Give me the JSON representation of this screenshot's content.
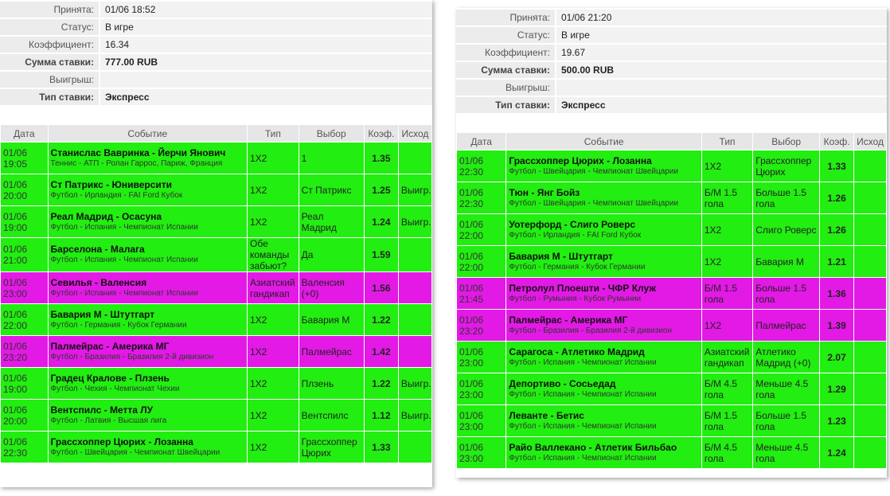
{
  "panels": [
    {
      "info": [
        {
          "label": "Принята:",
          "value": "01/06 18:52",
          "bold": false
        },
        {
          "label": "Статус:",
          "value": "В игре",
          "bold": false
        },
        {
          "label": "Коэффициент:",
          "value": "16.34",
          "bold": false
        },
        {
          "label": "Сумма ставки:",
          "value": "777.00 RUB",
          "bold": true
        },
        {
          "label": "Выигрыш:",
          "value": "",
          "bold": false
        },
        {
          "label": "Тип ставки:",
          "value": "Экспресс",
          "bold": true
        }
      ],
      "headers": [
        "Дата",
        "Событие",
        "Тип",
        "Выбор",
        "Коэф.",
        "Исход"
      ],
      "bets": [
        {
          "date": "01/06",
          "time": "19:05",
          "event": "Станислас Вавринка - Йерчи Янович",
          "sub": "Теннис - АТП - Ролан Гаррос, Париж, Франция",
          "type": "1Х2",
          "pick": "1",
          "odd": "1.35",
          "result": "",
          "color": "g"
        },
        {
          "date": "01/06",
          "time": "20:00",
          "event": "Ст Патрикс - Юниверсити",
          "sub": "Футбол - Ирландия - FAI Ford Кубок",
          "type": "1Х2",
          "pick": "Ст Патрикс",
          "odd": "1.25",
          "result": "Выигр.",
          "color": "g"
        },
        {
          "date": "01/06",
          "time": "19:00",
          "event": "Реал Мадрид - Осасуна",
          "sub": "Футбол - Испания - Чемпионат Испании",
          "type": "1Х2",
          "pick": "Реал Мадрид",
          "odd": "1.24",
          "result": "Выигр.",
          "color": "g"
        },
        {
          "date": "01/06",
          "time": "21:00",
          "event": "Барселона - Малага",
          "sub": "Футбол - Испания - Чемпионат Испании",
          "type": "Обе команды забьют?",
          "pick": "Да",
          "odd": "1.59",
          "result": "",
          "color": "g"
        },
        {
          "date": "01/06",
          "time": "23:00",
          "event": "Севилья - Валенсия",
          "sub": "Футбол - Испания - Чемпионат Испании",
          "type": "Азиатский гандикап",
          "pick": "Валенсия (+0)",
          "odd": "1.56",
          "result": "",
          "color": "m"
        },
        {
          "date": "01/06",
          "time": "22:00",
          "event": "Бавария М - Штутгарт",
          "sub": "Футбол - Германия - Кубок Германии",
          "type": "1Х2",
          "pick": "Бавария М",
          "odd": "1.22",
          "result": "",
          "color": "g"
        },
        {
          "date": "01/06",
          "time": "23:20",
          "event": "Палмейрас - Америка МГ",
          "sub": "Футбол - Бразилия - Бразилия 2-й дивизион",
          "type": "1Х2",
          "pick": "Палмейрас",
          "odd": "1.42",
          "result": "",
          "color": "m"
        },
        {
          "date": "01/06",
          "time": "19:00",
          "event": "Градец Кралове - Плзень",
          "sub": "Футбол - Чехия - Чемпионат Чехии",
          "type": "1Х2",
          "pick": "Плзень",
          "odd": "1.22",
          "result": "Выигр.",
          "color": "g"
        },
        {
          "date": "01/06",
          "time": "20:00",
          "event": "Вентспилс - Метта ЛУ",
          "sub": "Футбол - Латвия - Высшая лига",
          "type": "1Х2",
          "pick": "Вентспилс",
          "odd": "1.12",
          "result": "Выигр.",
          "color": "g"
        },
        {
          "date": "01/06",
          "time": "22:30",
          "event": "Грассхоппер Цюрих - Лозанна",
          "sub": "Футбол - Швейцария - Чемпионат Швейцарии",
          "type": "1Х2",
          "pick": "Грассхоппер Цюрих",
          "odd": "1.33",
          "result": "",
          "color": "g"
        }
      ]
    },
    {
      "info": [
        {
          "label": "Принята:",
          "value": "01/06 21:20",
          "bold": false
        },
        {
          "label": "Статус:",
          "value": "В игре",
          "bold": false
        },
        {
          "label": "Коэффициент:",
          "value": "19.67",
          "bold": false
        },
        {
          "label": "Сумма ставки:",
          "value": "500.00 RUB",
          "bold": true
        },
        {
          "label": "Выигрыш:",
          "value": "",
          "bold": false
        },
        {
          "label": "Тип ставки:",
          "value": "Экспресс",
          "bold": true
        }
      ],
      "headers": [
        "Дата",
        "Событие",
        "Тип",
        "Выбор",
        "Коэф.",
        "Исход"
      ],
      "bets": [
        {
          "date": "01/06",
          "time": "22:30",
          "event": "Грассхоппер Цюрих - Лозанна",
          "sub": "Футбол - Швейцария - Чемпионат Швейцарии",
          "type": "1Х2",
          "pick": "Грассхоппер Цюрих",
          "odd": "1.33",
          "result": "",
          "color": "g"
        },
        {
          "date": "01/06",
          "time": "22:30",
          "event": "Тюн - Янг Бойз",
          "sub": "Футбол - Швейцария - Чемпионат Швейцарии",
          "type": "Б/М 1.5 гола",
          "pick": "Больше 1.5 гола",
          "odd": "1.26",
          "result": "",
          "color": "g"
        },
        {
          "date": "01/06",
          "time": "22:00",
          "event": "Уотерфорд - Слиго Роверс",
          "sub": "Футбол - Ирландия - FAI Ford Кубок",
          "type": "1Х2",
          "pick": "Слиго Роверс",
          "odd": "1.26",
          "result": "",
          "color": "g"
        },
        {
          "date": "01/06",
          "time": "22:00",
          "event": "Бавария М - Штутгарт",
          "sub": "Футбол - Германия - Кубок Германии",
          "type": "1Х2",
          "pick": "Бавария М",
          "odd": "1.21",
          "result": "",
          "color": "g"
        },
        {
          "date": "01/06",
          "time": "21:45",
          "event": "Петролул Плоешти - ЧФР Клуж",
          "sub": "Футбол - Румыния - Кубок Румынии",
          "type": "Б/М 1.5 гола",
          "pick": "Больше 1.5 гола",
          "odd": "1.36",
          "result": "",
          "color": "m"
        },
        {
          "date": "01/06",
          "time": "23:20",
          "event": "Палмейрас - Америка МГ",
          "sub": "Футбол - Бразилия - Бразилия 2-й дивизион",
          "type": "1Х2",
          "pick": "Палмейрас",
          "odd": "1.39",
          "result": "",
          "color": "m"
        },
        {
          "date": "01/06",
          "time": "23:00",
          "event": "Сарагоса - Атлетико Мадрид",
          "sub": "Футбол - Испания - Чемпионат Испании",
          "type": "Азиатский гандикап",
          "pick": "Атлетико Мадрид (+0)",
          "odd": "2.07",
          "result": "",
          "color": "g"
        },
        {
          "date": "01/06",
          "time": "23:00",
          "event": "Депортиво - Сосьедад",
          "sub": "Футбол - Испания - Чемпионат Испании",
          "type": "Б/М 4.5 гола",
          "pick": "Меньше 4.5 гола",
          "odd": "1.29",
          "result": "",
          "color": "g"
        },
        {
          "date": "01/06",
          "time": "23:00",
          "event": "Леванте - Бетис",
          "sub": "Футбол - Испания - Чемпионат Испании",
          "type": "Б/М 1.5 гола",
          "pick": "Больше 1.5 гола",
          "odd": "1.23",
          "result": "",
          "color": "g"
        },
        {
          "date": "01/06",
          "time": "23:00",
          "event": "Райо Валлекано - Атлетик Бильбао",
          "sub": "Футбол - Испания - Чемпионат Испании",
          "type": "Б/М 4.5 гола",
          "pick": "Меньше 4.5 гола",
          "odd": "1.24",
          "result": "",
          "color": "g"
        }
      ]
    }
  ]
}
